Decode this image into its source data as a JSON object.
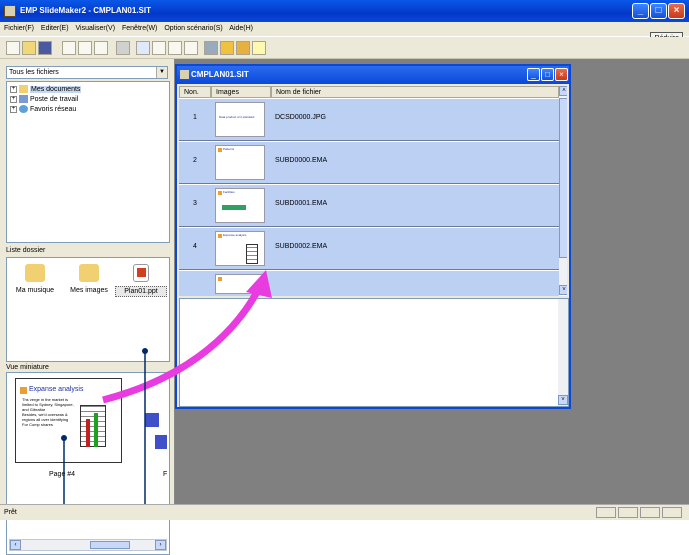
{
  "window": {
    "title": "EMP SlideMaker2 - CMPLAN01.SIT"
  },
  "menu": [
    "Fichier(F)",
    "Editer(E)",
    "Visualiser(V)",
    "Fenêtre(W)",
    "Option scénario(S)",
    "Aide(H)"
  ],
  "reduce_label": "Réduire",
  "left": {
    "combo_value": "Tous les fichiers",
    "tree": [
      {
        "label": "Mes documents",
        "selected": true
      },
      {
        "label": "Poste de travail",
        "selected": false
      },
      {
        "label": "Favoris réseau",
        "selected": false
      }
    ],
    "folder_list_label": "Liste dossier",
    "folder_items": [
      {
        "label": "Ma musique",
        "icon": "folder-music-icon"
      },
      {
        "label": "Mes images",
        "icon": "folder-pictures-icon"
      },
      {
        "label": "Plan01.ppt",
        "icon": "powerpoint-file-icon",
        "selected": true
      }
    ],
    "thumb_label": "Vue miniature",
    "thumb_title": "Expanse analysis",
    "thumb_bullets": [
      "Ths verge in the market is limited to Sydney, Singapore, and Gibraltar",
      "Besides, we'd overseas & regions all over identifying",
      "For Comp shares"
    ],
    "thumb_page": "Page #4",
    "thumb_page2": "F"
  },
  "child": {
    "title": "CMPLAN01.SIT",
    "headers": [
      "Non.",
      "Images",
      "Nom de fichier"
    ],
    "rows": [
      {
        "num": "1",
        "file": "DCSD0000.JPG",
        "img_title": "Data product of it standard"
      },
      {
        "num": "2",
        "file": "SUBD0000.EMA",
        "img_title": "Patterns"
      },
      {
        "num": "3",
        "file": "SUBD0001.EMA",
        "img_title": "Facilities"
      },
      {
        "num": "4",
        "file": "SUBD0002.EMA",
        "img_title": "Expanse analysis"
      }
    ]
  },
  "status": "Prêt",
  "colors": {
    "accent_arrow": "#e83ce0",
    "row_bg": "#bcd0f4",
    "titlebar": "#0a48d8"
  }
}
